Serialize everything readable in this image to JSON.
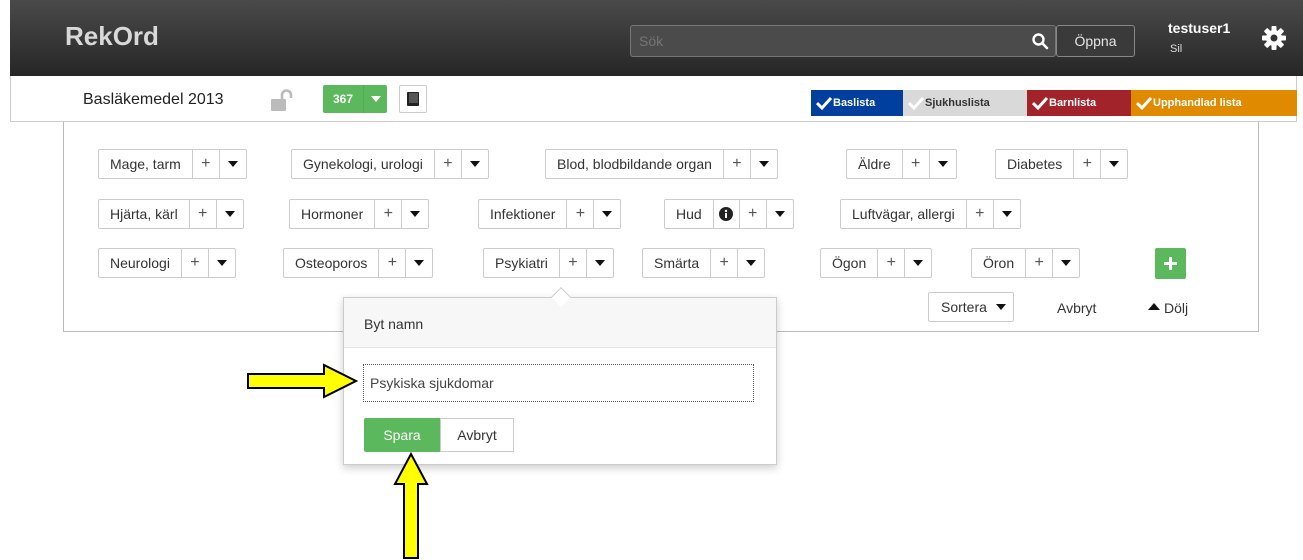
{
  "app": {
    "brand": "RekOrd"
  },
  "search": {
    "placeholder": "Sök",
    "icon": "search-icon"
  },
  "header": {
    "open_label": "Öppna",
    "username": "testuser1",
    "user_sub": "Sil"
  },
  "document": {
    "title": "Basläkemedel 2013",
    "count": "367"
  },
  "lists": [
    {
      "label": "Baslista",
      "color": "#003f9e"
    },
    {
      "label": "Sjukhuslista",
      "color": "#d9d9d9"
    },
    {
      "label": "Barnlista",
      "color": "#a3232a"
    },
    {
      "label": "Upphandlad lista",
      "color": "#e08a00"
    }
  ],
  "categories": [
    {
      "label": "Mage, tarm"
    },
    {
      "label": "Gynekologi, urologi"
    },
    {
      "label": "Blod, blodbildande organ"
    },
    {
      "label": "Äldre"
    },
    {
      "label": "Diabetes"
    },
    {
      "label": "Hjärta, kärl"
    },
    {
      "label": "Hormoner"
    },
    {
      "label": "Infektioner"
    },
    {
      "label": "Hud"
    },
    {
      "label": "Luftvägar, allergi"
    },
    {
      "label": "Neurologi"
    },
    {
      "label": "Osteoporos"
    },
    {
      "label": "Psykiatri"
    },
    {
      "label": "Smärta"
    },
    {
      "label": "Ögon"
    },
    {
      "label": "Öron"
    }
  ],
  "panel": {
    "plus_symbol": "+",
    "sort_label": "Sortera",
    "cancel_label": "Avbryt",
    "hide_label": "Dölj"
  },
  "rename": {
    "title": "Byt namn",
    "value": "Psykiska sjukdomar",
    "save_label": "Spara",
    "cancel_label": "Avbryt"
  },
  "colors": {
    "accent_green": "#5cb85c",
    "annotation_arrow": "#ffff00"
  }
}
